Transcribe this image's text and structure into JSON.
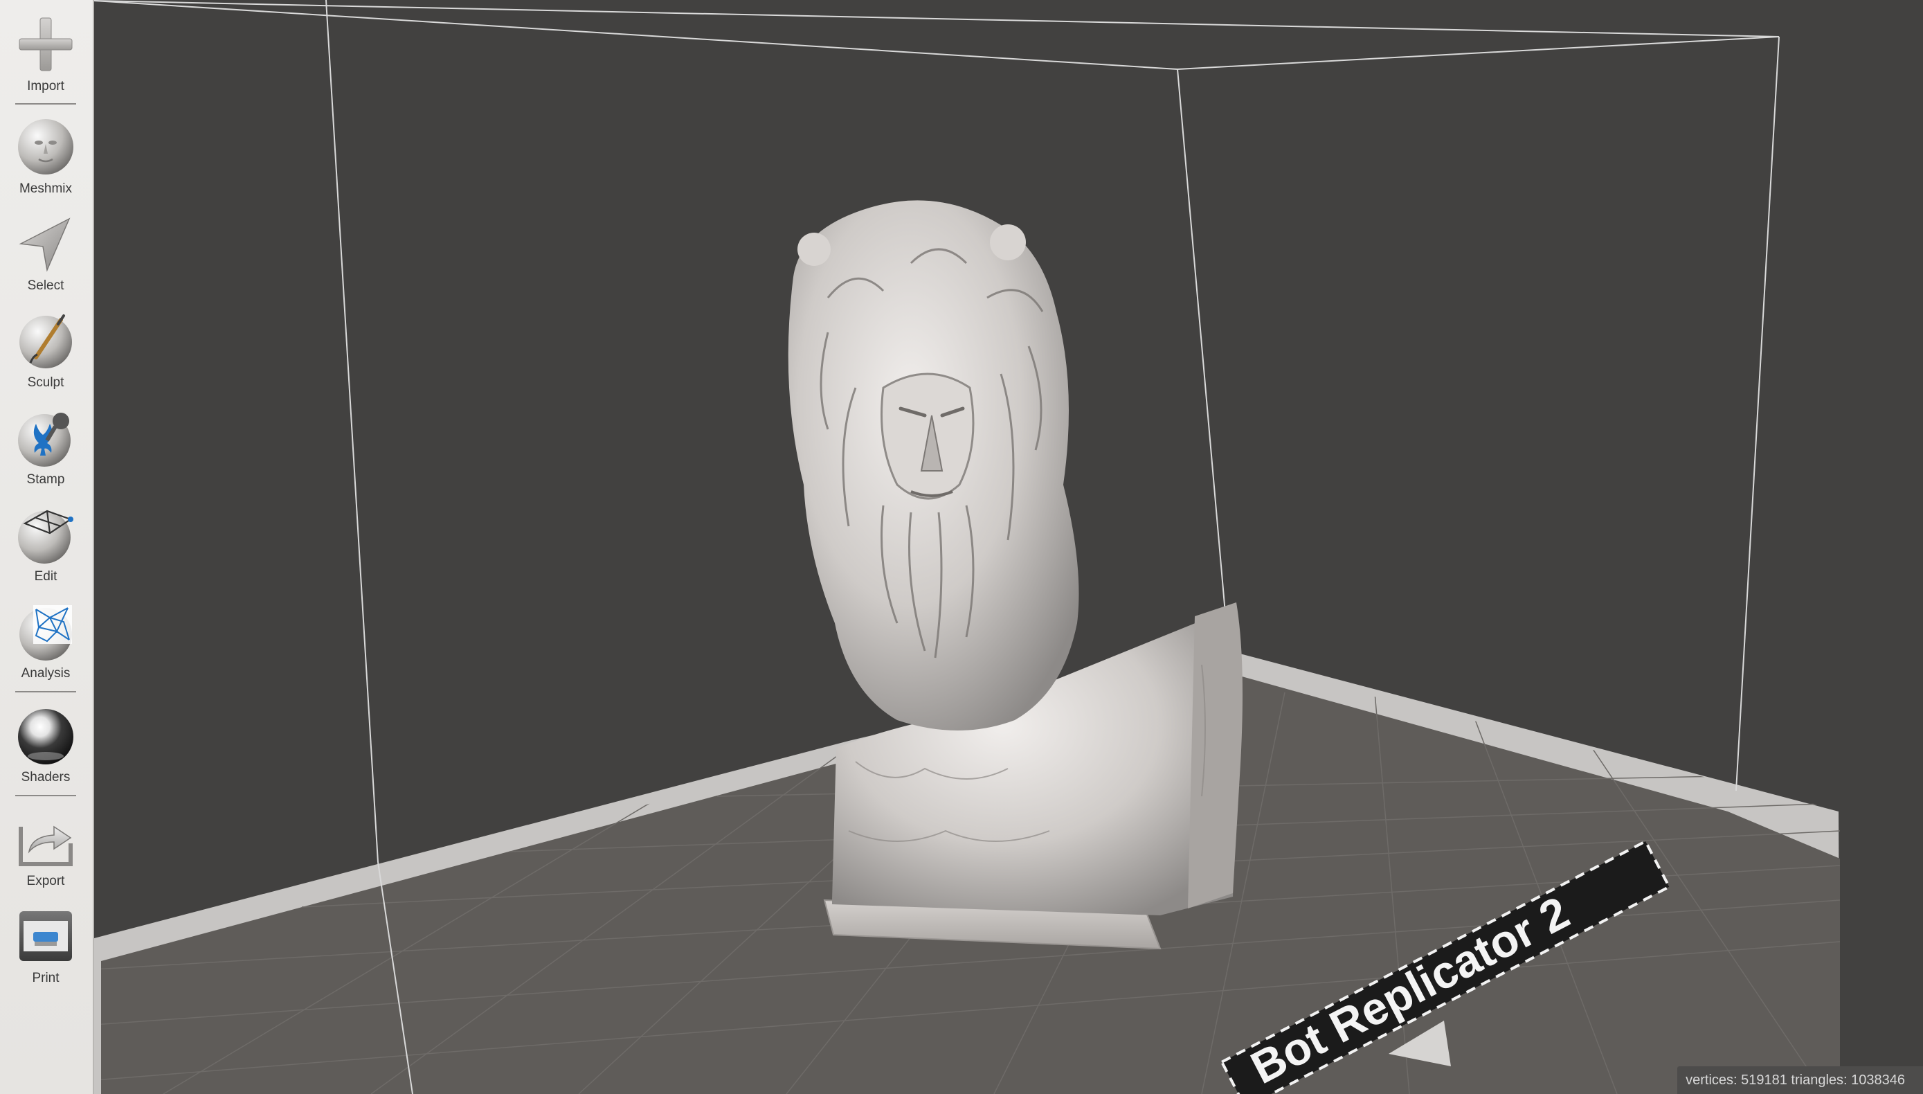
{
  "toolbar": {
    "items": [
      {
        "label": "Import",
        "icon": "plus-icon"
      },
      {
        "label": "Meshmix",
        "icon": "meshmix-face-sphere-icon"
      },
      {
        "label": "Select",
        "icon": "arrow-pointer-icon"
      },
      {
        "label": "Sculpt",
        "icon": "brush-sphere-icon"
      },
      {
        "label": "Stamp",
        "icon": "fleur-de-lis-stamp-icon"
      },
      {
        "label": "Edit",
        "icon": "edit-mesh-sphere-icon"
      },
      {
        "label": "Analysis",
        "icon": "mesh-sphere-icon"
      },
      {
        "label": "Shaders",
        "icon": "chrome-sphere-icon"
      },
      {
        "label": "Export",
        "icon": "export-tray-icon"
      },
      {
        "label": "Print",
        "icon": "printer-icon"
      }
    ]
  },
  "viewport": {
    "printer_label": "Bot Replicator 2",
    "model_name": "bearded-bust-model",
    "status": "vertices: 519181 triangles: 1038346"
  },
  "colors": {
    "background": "#424140",
    "floor": "#5f5c59",
    "platform_border": "#c7c5c3",
    "model": "#cfcbc8"
  }
}
